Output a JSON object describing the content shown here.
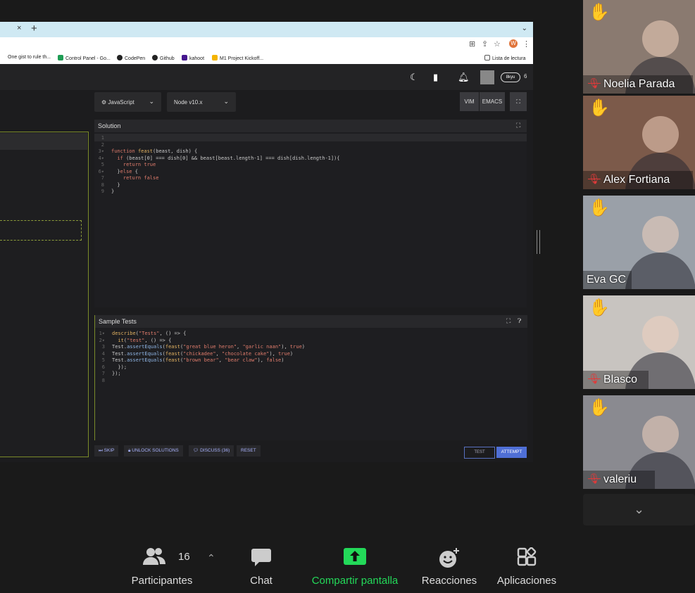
{
  "browser": {
    "tab_close": "×",
    "new_tab": "+",
    "bookmarks": [
      {
        "label": "One gist to rule th...",
        "color": "#ffffff"
      },
      {
        "label": "Control Panel - Go...",
        "color": "#1f9d55"
      },
      {
        "label": "CodePen",
        "color": "#222222"
      },
      {
        "label": "Github",
        "color": "#222222"
      },
      {
        "label": "kahoot",
        "color": "#46178f"
      },
      {
        "label": "M1 Project Kickoff...",
        "color": "#f4b400"
      }
    ],
    "reading_list": "Lista de lectura",
    "profile_initial": "W"
  },
  "codewars": {
    "rank": "8kyu",
    "honor": "6",
    "language": "JavaScript",
    "version": "Node v10.x",
    "mode_buttons": [
      "VIM",
      "EMACS"
    ],
    "solution_title": "Solution",
    "sample_tests_title": "Sample Tests",
    "solution_lines": [
      {
        "n": "1",
        "code": ""
      },
      {
        "n": "2",
        "code": ""
      },
      {
        "n": "3▾",
        "code": "function feast(beast, dish) {"
      },
      {
        "n": "4▾",
        "code": "  if (beast[0] === dish[0] && beast[beast.length-1] === dish[dish.length-1]){"
      },
      {
        "n": "5",
        "code": "    return true"
      },
      {
        "n": "6▾",
        "code": "  }else {"
      },
      {
        "n": "7",
        "code": "    return false"
      },
      {
        "n": "8",
        "code": "  }"
      },
      {
        "n": "9",
        "code": "}"
      }
    ],
    "test_lines": [
      {
        "n": "1▾",
        "code": "describe(\"Tests\", () => {"
      },
      {
        "n": "2▾",
        "code": "  it(\"test\", () => {"
      },
      {
        "n": "3",
        "code": "Test.assertEquals(feast(\"great blue heron\", \"garlic naan\"), true)"
      },
      {
        "n": "4",
        "code": "Test.assertEquals(feast(\"chickadee\", \"chocolate cake\"), true)"
      },
      {
        "n": "5",
        "code": "Test.assertEquals(feast(\"brown bear\", \"bear claw\"), false)"
      },
      {
        "n": "6",
        "code": "  });"
      },
      {
        "n": "7",
        "code": "});"
      },
      {
        "n": "8",
        "code": ""
      }
    ],
    "actions": {
      "skip": "SKIP",
      "unlock": "UNLOCK SOLUTIONS",
      "discuss": "DISCUSS (36)",
      "reset": "RESET",
      "test": "TEST",
      "attempt": "ATTEMPT"
    }
  },
  "participants": [
    {
      "name": "Noelia Parada",
      "muted": true,
      "hand_raised": true,
      "bg": "#8a7a70"
    },
    {
      "name": "Alex Fortiana",
      "muted": true,
      "hand_raised": true,
      "bg": "#7c5a4a"
    },
    {
      "name": "Eva GC",
      "muted": false,
      "hand_raised": true,
      "bg": "#9aa0a8"
    },
    {
      "name": "Blasco",
      "muted": true,
      "hand_raised": true,
      "bg": "#c8c4c0"
    },
    {
      "name": "valeriu",
      "muted": true,
      "hand_raised": true,
      "bg": "#8a8a90"
    }
  ],
  "toolbar": {
    "participants_label": "Participantes",
    "participants_count": "16",
    "chat_label": "Chat",
    "share_label": "Compartir pantalla",
    "reactions_label": "Reacciones",
    "apps_label": "Aplicaciones",
    "share_color": "#23d959"
  }
}
